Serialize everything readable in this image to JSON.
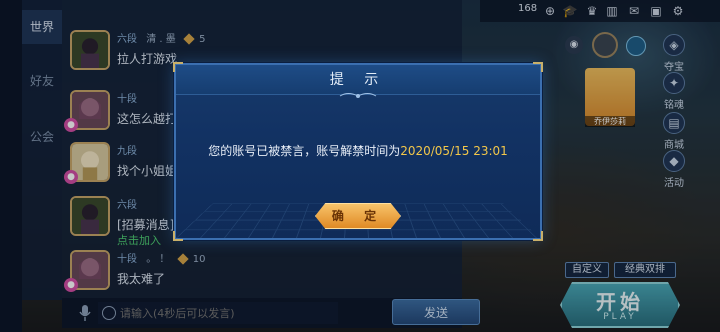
{
  "tabs": [
    {
      "label": "世界"
    },
    {
      "label": "好友"
    },
    {
      "label": "公会"
    }
  ],
  "chat": {
    "messages": [
      {
        "rank": "六段",
        "name": "清 . 墨",
        "level": "5",
        "text": "拉人打游戏",
        "sub": ""
      },
      {
        "rank": "十段",
        "name": "",
        "level": "",
        "text": "这怎么越打越菜了？",
        "sub": ""
      },
      {
        "rank": "九段",
        "name": "",
        "level": "",
        "text": "找个小姐姐",
        "sub": ""
      },
      {
        "rank": "六段",
        "name": "",
        "level": "",
        "text": "[招募消息]",
        "sub": "点击加入"
      },
      {
        "rank": "十段",
        "name": "。 ！",
        "level": "10",
        "text": "我太难了",
        "sub": ""
      }
    ]
  },
  "input": {
    "placeholder": "请输入(4秒后可以发言)"
  },
  "send": {
    "label": "发送"
  },
  "topbar": {
    "coins": "168"
  },
  "side": [
    {
      "label": "夺宝"
    },
    {
      "label": "铭魂"
    },
    {
      "label": "商城"
    },
    {
      "label": "活动"
    }
  ],
  "hero": {
    "name": "乔伊莎莉"
  },
  "buttons": {
    "custom": "自定义",
    "classic": "经典双排",
    "start": "开始",
    "play": "PLAY"
  },
  "dialog": {
    "title": "提 示",
    "message_prefix": "您的账号已被禁言，账号解禁时间为",
    "ban_until": "2020/05/15 23:01",
    "confirm": "确 定"
  },
  "colors": {
    "accent_gold": "#f2c74a",
    "green_text": "#4fcf74",
    "dialog_bg": "#123263",
    "confirm_orange": "#e08a25"
  }
}
